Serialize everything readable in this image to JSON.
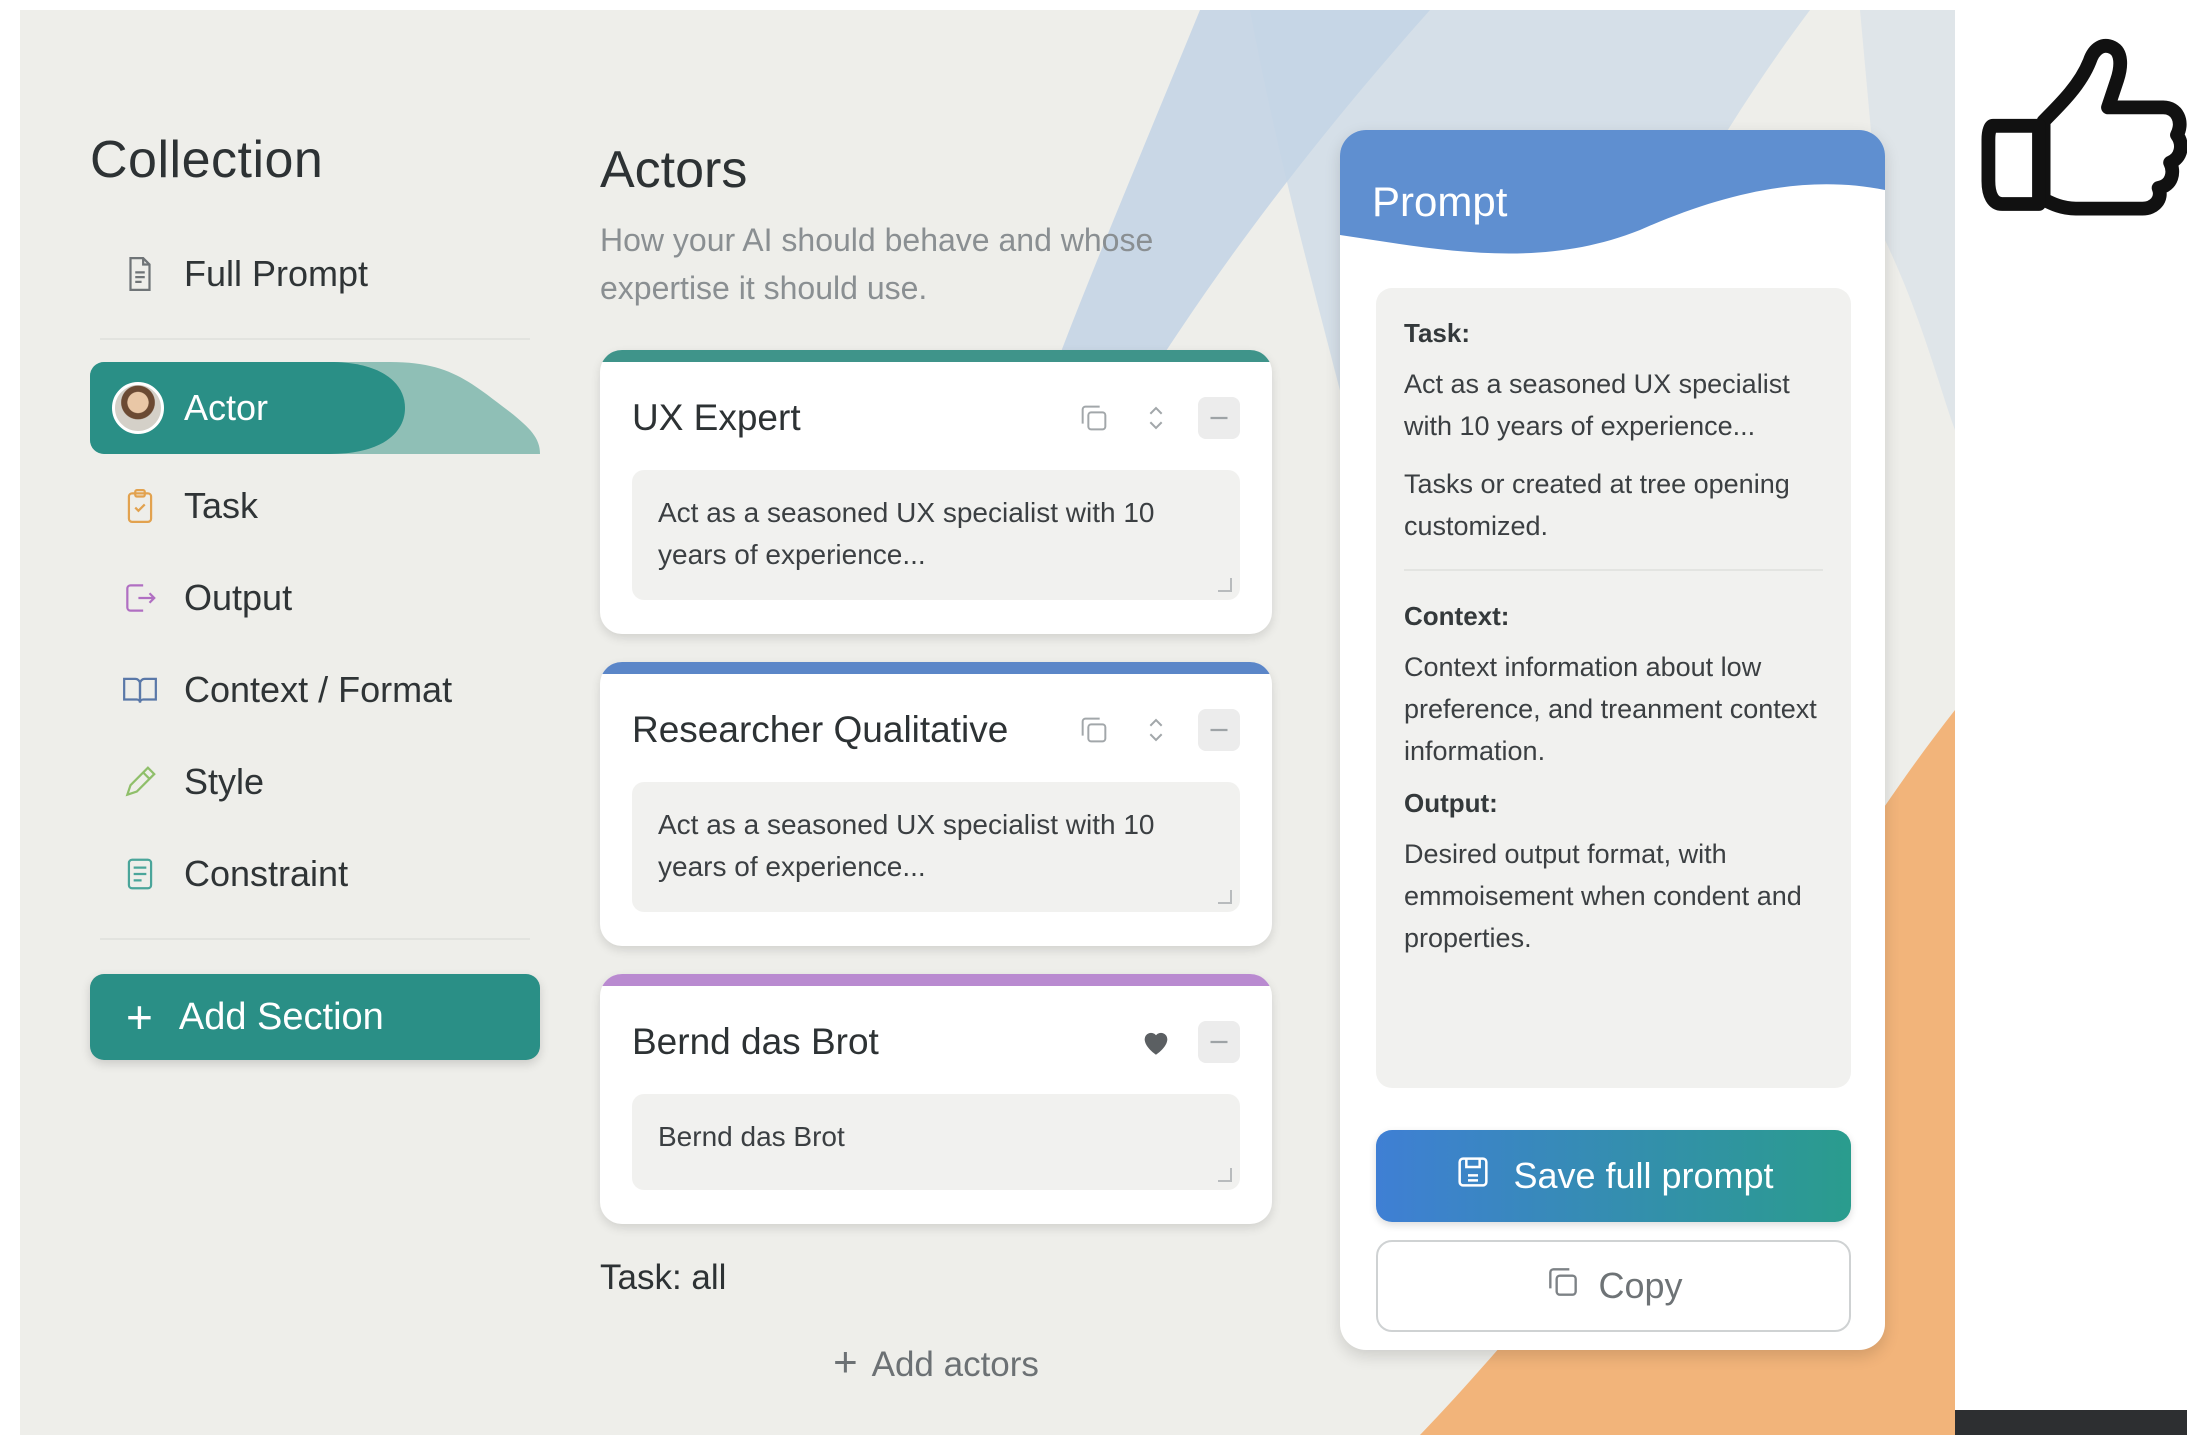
{
  "sidebar": {
    "title": "Collection",
    "items": [
      {
        "label": "Full Prompt",
        "icon": "document-icon"
      },
      {
        "label": "Actor",
        "icon": "avatar",
        "active": true
      },
      {
        "label": "Task",
        "icon": "clipboard-check-icon"
      },
      {
        "label": "Output",
        "icon": "export-icon"
      },
      {
        "label": "Context / Format",
        "icon": "book-icon"
      },
      {
        "label": "Style",
        "icon": "pencil-icon"
      },
      {
        "label": "Constraint",
        "icon": "list-doc-icon"
      }
    ],
    "add_section_label": "Add Section"
  },
  "actors": {
    "title": "Actors",
    "subtitle": "How your AI should behave and whose expertise it should use.",
    "cards": [
      {
        "title": "UX Expert",
        "text": "Act as a seasoned UX specialist with 10 years of experience..."
      },
      {
        "title": "Researcher Qualitative",
        "text": "Act as a seasoned UX specialist with 10 years of experience..."
      },
      {
        "title": "Bernd das Brot",
        "text": "Bernd das Brot"
      }
    ],
    "task_line": "Task: all",
    "add_actors_label": "Add actors"
  },
  "prompt": {
    "title": "Prompt",
    "task_label": "Task:",
    "task_text_1": "Act as a seasoned UX specialist with 10 years of experience...",
    "task_text_2": "Tasks or created at tree opening customized.",
    "context_label": "Context:",
    "context_text": "Context information about low preference, and treanment context information.",
    "output_label": "Output:",
    "output_text": "Desired output format, with emmoisement when condent and properties.",
    "save_label": "Save full prompt",
    "copy_label": "Copy"
  },
  "colors": {
    "teal": "#2a8f86",
    "blue": "#4b87d6",
    "orange": "#f2b47a",
    "background": "#eeeeea"
  }
}
